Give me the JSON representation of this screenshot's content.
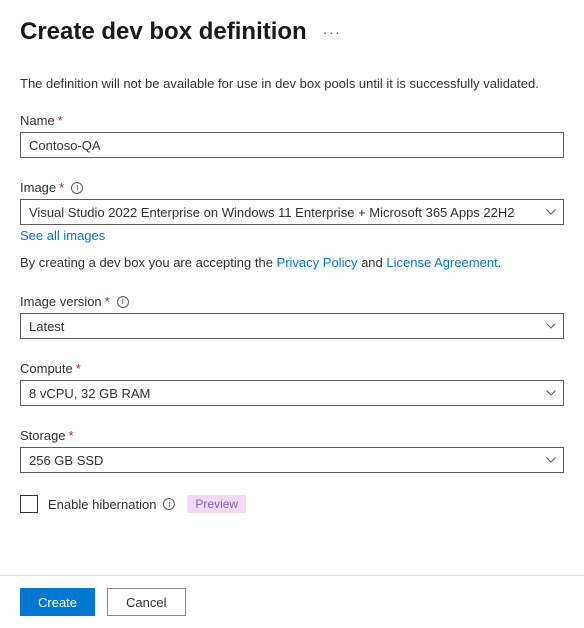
{
  "header": {
    "title": "Create dev box definition"
  },
  "description": "The definition will not be available for use in dev box pools until it is successfully validated.",
  "fields": {
    "name": {
      "label": "Name",
      "value": "Contoso-QA"
    },
    "image": {
      "label": "Image",
      "value": "Visual Studio 2022 Enterprise on Windows 11 Enterprise + Microsoft 365 Apps 22H2",
      "see_all": "See all images"
    },
    "accept": {
      "prefix": "By creating a dev box you are accepting the ",
      "privacy": "Privacy Policy",
      "and": " and ",
      "license": "License Agreement",
      "suffix": "."
    },
    "image_version": {
      "label": "Image version",
      "value": "Latest"
    },
    "compute": {
      "label": "Compute",
      "value": "8 vCPU, 32 GB RAM"
    },
    "storage": {
      "label": "Storage",
      "value": "256 GB SSD"
    },
    "hibernation": {
      "label": "Enable hibernation",
      "badge": "Preview"
    }
  },
  "footer": {
    "create": "Create",
    "cancel": "Cancel"
  }
}
